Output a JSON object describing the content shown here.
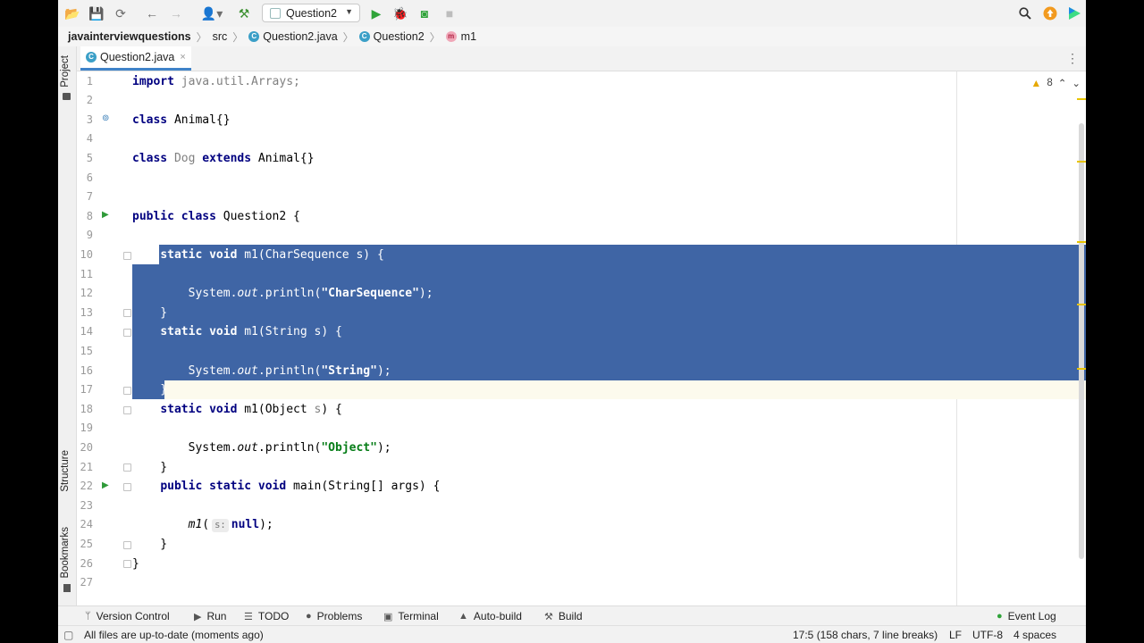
{
  "toolbar": {
    "run_config": "Question2"
  },
  "breadcrumb": {
    "project": "javainterviewquestions",
    "folder": "src",
    "file": "Question2.java",
    "class": "Question2",
    "method": "m1",
    "class_icon_letter": "C",
    "method_icon_letter": "m"
  },
  "left_stripe": {
    "project": "Project",
    "structure": "Structure",
    "bookmarks": "Bookmarks"
  },
  "tabs": {
    "active": "Question2.java",
    "close": "×"
  },
  "editor": {
    "warnings_count": "8",
    "lines": [
      {
        "n": "1",
        "parts": [
          [
            "kw",
            "import"
          ],
          [
            "gray",
            " java.util.Arrays;"
          ]
        ]
      },
      {
        "n": "2",
        "parts": []
      },
      {
        "n": "3",
        "parts": [
          [
            "kw",
            "class"
          ],
          [
            "",
            " Animal{}"
          ]
        ]
      },
      {
        "n": "4",
        "parts": []
      },
      {
        "n": "5",
        "parts": [
          [
            "kw",
            "class"
          ],
          [
            "gray",
            " Dog"
          ],
          [
            "kw",
            " extends"
          ],
          [
            "",
            " Animal{}"
          ]
        ]
      },
      {
        "n": "6",
        "parts": []
      },
      {
        "n": "7",
        "parts": []
      },
      {
        "n": "8",
        "parts": [
          [
            "kw",
            "public class"
          ],
          [
            "",
            " Question2 {"
          ]
        ]
      },
      {
        "n": "9",
        "parts": []
      },
      {
        "n": "10",
        "parts": [
          [
            "",
            "    "
          ],
          [
            "kw",
            "static void"
          ],
          [
            "",
            " m1(CharSequence s) {"
          ]
        ]
      },
      {
        "n": "11",
        "parts": []
      },
      {
        "n": "12",
        "parts": [
          [
            "",
            "        System."
          ],
          [
            "it",
            "out"
          ],
          [
            "",
            ".println("
          ],
          [
            "str",
            "\"CharSequence\""
          ],
          [
            "",
            ");"
          ]
        ]
      },
      {
        "n": "13",
        "parts": [
          [
            "",
            "    }"
          ]
        ]
      },
      {
        "n": "14",
        "parts": [
          [
            "",
            "    "
          ],
          [
            "kw",
            "static void"
          ],
          [
            "",
            " m1(String s) {"
          ]
        ]
      },
      {
        "n": "15",
        "parts": []
      },
      {
        "n": "16",
        "parts": [
          [
            "",
            "        System."
          ],
          [
            "it",
            "out"
          ],
          [
            "",
            ".println("
          ],
          [
            "str",
            "\"String\""
          ],
          [
            "",
            ");"
          ]
        ]
      },
      {
        "n": "17",
        "parts": [
          [
            "",
            "    }"
          ]
        ]
      },
      {
        "n": "18",
        "parts": [
          [
            "",
            "    "
          ],
          [
            "kw",
            "static void"
          ],
          [
            "",
            " m1(Object "
          ],
          [
            "gray",
            "s"
          ],
          [
            "",
            ") {"
          ]
        ]
      },
      {
        "n": "19",
        "parts": []
      },
      {
        "n": "20",
        "parts": [
          [
            "",
            "        System."
          ],
          [
            "it",
            "out"
          ],
          [
            "",
            ".println("
          ],
          [
            "str",
            "\"Object\""
          ],
          [
            "",
            ");"
          ]
        ]
      },
      {
        "n": "21",
        "parts": [
          [
            "",
            "    }"
          ]
        ]
      },
      {
        "n": "22",
        "parts": [
          [
            "",
            "    "
          ],
          [
            "kw",
            "public static void"
          ],
          [
            "",
            " main(String[] args) {"
          ]
        ]
      },
      {
        "n": "23",
        "parts": []
      },
      {
        "n": "24",
        "parts": [
          [
            "",
            "        "
          ],
          [
            "it",
            "m1"
          ],
          [
            "",
            "("
          ],
          [
            "hint",
            "s:"
          ],
          [
            "kw",
            "null"
          ],
          [
            "",
            ");"
          ]
        ]
      },
      {
        "n": "25",
        "parts": [
          [
            "",
            "    }"
          ]
        ]
      },
      {
        "n": "26",
        "parts": [
          [
            "",
            "}"
          ]
        ]
      },
      {
        "n": "27",
        "parts": []
      }
    ]
  },
  "toolwindows": {
    "version_control": "Version Control",
    "run": "Run",
    "todo": "TODO",
    "problems": "Problems",
    "terminal": "Terminal",
    "auto_build": "Auto-build",
    "build": "Build",
    "event_log": "Event Log"
  },
  "status": {
    "message": "All files are up-to-date (moments ago)",
    "position": "17:5 (158 chars, 7 line breaks)",
    "line_sep": "LF",
    "encoding": "UTF-8",
    "indent": "4 spaces"
  },
  "colors": {
    "selection": "#3f65a5",
    "keyword": "#000080",
    "string": "#067d17",
    "accent": "#4083c9"
  }
}
